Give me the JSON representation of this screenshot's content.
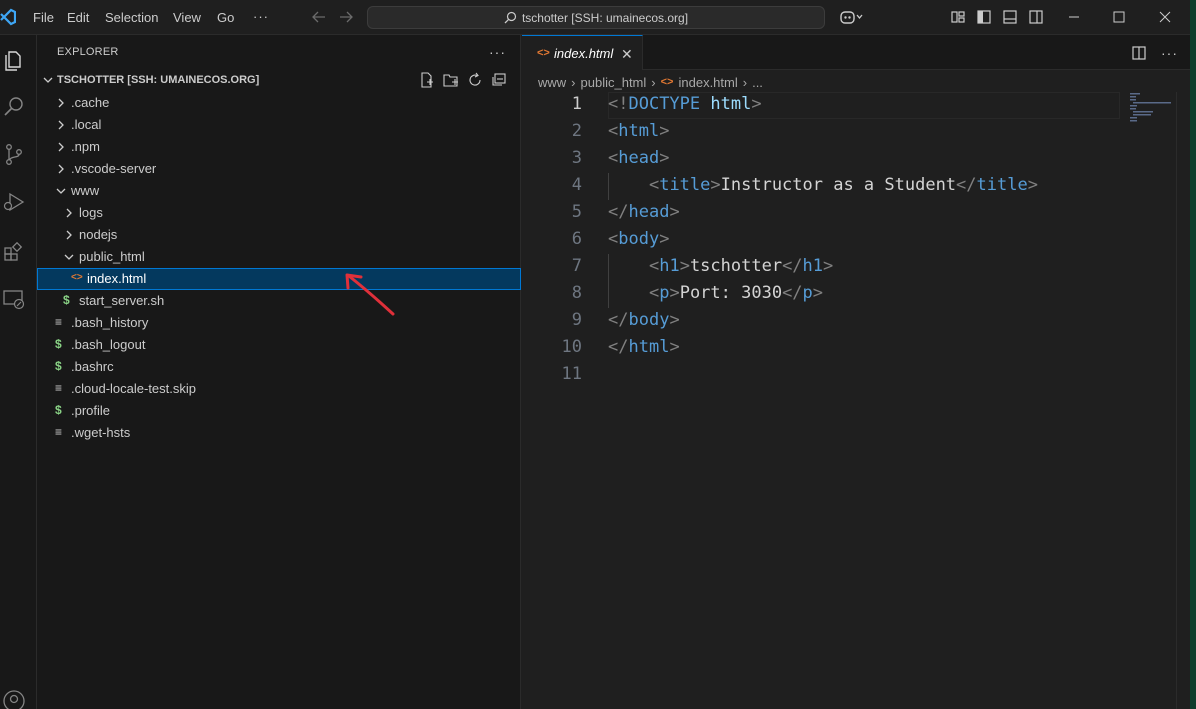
{
  "titlebar": {
    "menu": [
      "File",
      "Edit",
      "Selection",
      "View",
      "Go"
    ],
    "menu_more": "···",
    "command_center": "tschotter [SSH: umainecos.org]"
  },
  "activity": {
    "icons": [
      "explorer-icon",
      "search-icon",
      "source-control-icon",
      "run-debug-icon",
      "extensions-icon",
      "remote-explorer-icon",
      "account-icon"
    ]
  },
  "sidebar": {
    "header": "EXPLORER",
    "more": "···",
    "section_title": "TSCHOTTER [SSH: UMAINECOS.ORG]",
    "tree": [
      {
        "label": ".cache",
        "type": "folder",
        "depth": 0,
        "expanded": false
      },
      {
        "label": ".local",
        "type": "folder",
        "depth": 0,
        "expanded": false
      },
      {
        "label": ".npm",
        "type": "folder",
        "depth": 0,
        "expanded": false
      },
      {
        "label": ".vscode-server",
        "type": "folder",
        "depth": 0,
        "expanded": false
      },
      {
        "label": "www",
        "type": "folder",
        "depth": 0,
        "expanded": true
      },
      {
        "label": "logs",
        "type": "folder",
        "depth": 1,
        "expanded": false
      },
      {
        "label": "nodejs",
        "type": "folder",
        "depth": 1,
        "expanded": false
      },
      {
        "label": "public_html",
        "type": "folder",
        "depth": 1,
        "expanded": true
      },
      {
        "label": "index.html",
        "type": "html",
        "depth": 2,
        "selected": true
      },
      {
        "label": "start_server.sh",
        "type": "shell",
        "depth": 1
      },
      {
        "label": ".bash_history",
        "type": "text",
        "depth": 0
      },
      {
        "label": ".bash_logout",
        "type": "shell",
        "depth": 0
      },
      {
        "label": ".bashrc",
        "type": "shell",
        "depth": 0
      },
      {
        "label": ".cloud-locale-test.skip",
        "type": "text",
        "depth": 0
      },
      {
        "label": ".profile",
        "type": "shell",
        "depth": 0
      },
      {
        "label": ".wget-hsts",
        "type": "text",
        "depth": 0
      }
    ]
  },
  "editor": {
    "tab_label": "index.html",
    "tab_icon": "<>",
    "tab_close": "✕",
    "breadcrumbs": [
      "www",
      "public_html",
      "index.html",
      "..."
    ],
    "active_line": 1,
    "lines": [
      {
        "n": "1",
        "tokens": [
          [
            "punct",
            "<!"
          ],
          [
            "doctype",
            "DOCTYPE "
          ],
          [
            "doctype-name",
            "html"
          ],
          [
            "punct",
            ">"
          ]
        ]
      },
      {
        "n": "2",
        "tokens": [
          [
            "punct",
            "<"
          ],
          [
            "tag",
            "html"
          ],
          [
            "punct",
            ">"
          ]
        ]
      },
      {
        "n": "3",
        "tokens": [
          [
            "punct",
            "<"
          ],
          [
            "tag",
            "head"
          ],
          [
            "punct",
            ">"
          ]
        ]
      },
      {
        "n": "4",
        "tokens": [
          [
            "text",
            "    "
          ],
          [
            "punct",
            "<"
          ],
          [
            "tag",
            "title"
          ],
          [
            "punct",
            ">"
          ],
          [
            "text",
            "Instructor as a Student"
          ],
          [
            "punct",
            "</"
          ],
          [
            "tag",
            "title"
          ],
          [
            "punct",
            ">"
          ]
        ]
      },
      {
        "n": "5",
        "tokens": [
          [
            "punct",
            "</"
          ],
          [
            "tag",
            "head"
          ],
          [
            "punct",
            ">"
          ]
        ]
      },
      {
        "n": "6",
        "tokens": [
          [
            "punct",
            "<"
          ],
          [
            "tag",
            "body"
          ],
          [
            "punct",
            ">"
          ]
        ]
      },
      {
        "n": "7",
        "tokens": [
          [
            "text",
            "    "
          ],
          [
            "punct",
            "<"
          ],
          [
            "tag",
            "h1"
          ],
          [
            "punct",
            ">"
          ],
          [
            "text",
            "tschotter"
          ],
          [
            "punct",
            "</"
          ],
          [
            "tag",
            "h1"
          ],
          [
            "punct",
            ">"
          ]
        ]
      },
      {
        "n": "8",
        "tokens": [
          [
            "text",
            "    "
          ],
          [
            "punct",
            "<"
          ],
          [
            "tag",
            "p"
          ],
          [
            "punct",
            ">"
          ],
          [
            "text",
            "Port: 3030"
          ],
          [
            "punct",
            "</"
          ],
          [
            "tag",
            "p"
          ],
          [
            "punct",
            ">"
          ]
        ]
      },
      {
        "n": "9",
        "tokens": [
          [
            "punct",
            "</"
          ],
          [
            "tag",
            "body"
          ],
          [
            "punct",
            ">"
          ]
        ]
      },
      {
        "n": "10",
        "tokens": [
          [
            "punct",
            "</"
          ],
          [
            "tag",
            "html"
          ],
          [
            "punct",
            ">"
          ]
        ]
      },
      {
        "n": "11",
        "tokens": []
      }
    ]
  },
  "colors": {
    "accent": "#0078d4",
    "selection": "#04395e",
    "html_icon": "#e37933",
    "shell_icon": "#89d185",
    "annotation_arrow": "#e0303a"
  }
}
